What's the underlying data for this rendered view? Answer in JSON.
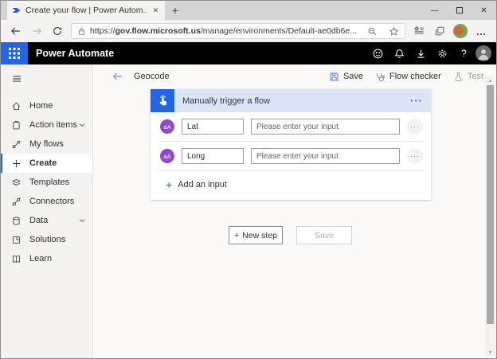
{
  "browser": {
    "tab": {
      "title": "Create your flow | Power Autom...",
      "close_glyph": "✕",
      "favicon": "power-automate-logo"
    },
    "new_tab_glyph": "+",
    "window_controls": {
      "minimize_glyph": "—",
      "close_glyph": "✕"
    },
    "address": {
      "url_prefix": "https://",
      "url_domain": "gov.flow.microsoft.us",
      "url_path": "/manage/environments/Default-ae0db6e...",
      "more_glyph": "…"
    }
  },
  "app_header": {
    "title": "Power Automate",
    "help_glyph": "?"
  },
  "sidebar": {
    "items": [
      {
        "label": "Home",
        "icon": "home-icon",
        "expandable": false,
        "selected": false
      },
      {
        "label": "Action items",
        "icon": "action-items-icon",
        "expandable": true,
        "selected": false
      },
      {
        "label": "My flows",
        "icon": "my-flows-icon",
        "expandable": false,
        "selected": false
      },
      {
        "label": "Create",
        "icon": "create-icon",
        "expandable": false,
        "selected": true
      },
      {
        "label": "Templates",
        "icon": "templates-icon",
        "expandable": false,
        "selected": false
      },
      {
        "label": "Connectors",
        "icon": "connectors-icon",
        "expandable": false,
        "selected": false
      },
      {
        "label": "Data",
        "icon": "data-icon",
        "expandable": true,
        "selected": false
      },
      {
        "label": "Solutions",
        "icon": "solutions-icon",
        "expandable": false,
        "selected": false
      },
      {
        "label": "Learn",
        "icon": "learn-icon",
        "expandable": false,
        "selected": false
      }
    ]
  },
  "flow_toolbar": {
    "flow_name": "Geocode",
    "save_label": "Save",
    "flow_checker_label": "Flow checker",
    "test_label": "Test"
  },
  "trigger_card": {
    "title": "Manually trigger a flow",
    "menu_glyph": "···",
    "inputs": [
      {
        "badge": "aA",
        "name": "Lat",
        "placeholder": "Please enter your input",
        "menu_glyph": "···"
      },
      {
        "badge": "aA",
        "name": "Long",
        "placeholder": "Please enter your input",
        "menu_glyph": "···"
      }
    ],
    "add_input": {
      "plus_glyph": "+",
      "label": "Add an input"
    }
  },
  "footer_actions": {
    "new_step": {
      "plus_glyph": "+",
      "label": "New step"
    },
    "save_label": "Save"
  },
  "colors": {
    "accent_blue": "#2266e3",
    "badge_purple": "#8f4bce",
    "trigger_header_bg": "#dbe5f7",
    "app_header_bg": "#000000",
    "sidebar_bg": "#f3f2f1"
  }
}
